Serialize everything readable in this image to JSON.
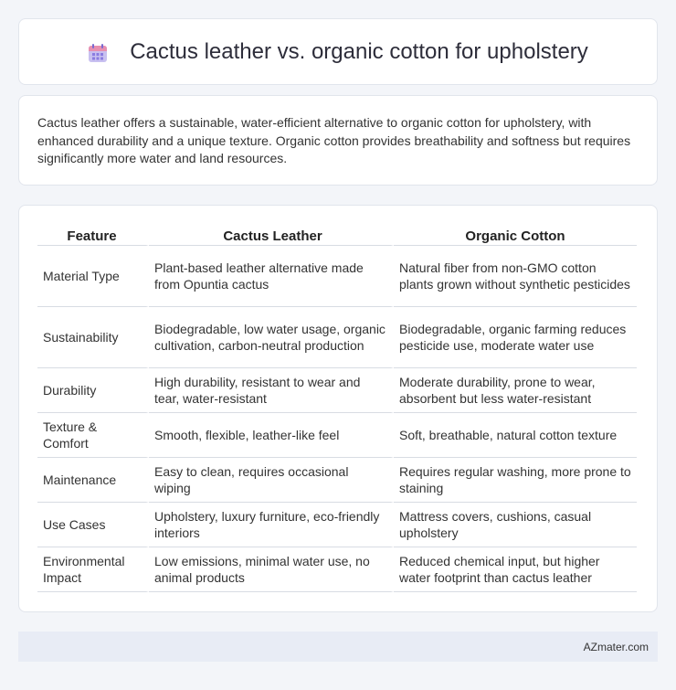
{
  "header": {
    "title": "Cactus leather vs. organic cotton for upholstery",
    "icon": "calendar-icon"
  },
  "intro": {
    "text": "Cactus leather offers a sustainable, water-efficient alternative to organic cotton for upholstery, with enhanced durability and a unique texture. Organic cotton provides breathability and softness but requires significantly more water and land resources."
  },
  "table": {
    "headers": [
      "Feature",
      "Cactus Leather",
      "Organic Cotton"
    ],
    "rows": [
      [
        "Material Type",
        "Plant-based leather alternative made from Opuntia cactus",
        "Natural fiber from non-GMO cotton plants grown without synthetic pesticides"
      ],
      [
        "Sustainability",
        "Biodegradable, low water usage, organic cultivation, carbon-neutral production",
        "Biodegradable, organic farming reduces pesticide use, moderate water use"
      ],
      [
        "Durability",
        "High durability, resistant to wear and tear, water-resistant",
        "Moderate durability, prone to wear, absorbent but less water-resistant"
      ],
      [
        "Texture & Comfort",
        "Smooth, flexible, leather-like feel",
        "Soft, breathable, natural cotton texture"
      ],
      [
        "Maintenance",
        "Easy to clean, requires occasional wiping",
        "Requires regular washing, more prone to staining"
      ],
      [
        "Use Cases",
        "Upholstery, luxury furniture, eco-friendly interiors",
        "Mattress covers, cushions, casual upholstery"
      ],
      [
        "Environmental Impact",
        "Low emissions, minimal water use, no animal products",
        "Reduced chemical input, but higher water footprint than cactus leather"
      ]
    ]
  },
  "footer": {
    "brand": "AZmater.com"
  },
  "colors": {
    "background": "#f3f5f9",
    "card": "#ffffff",
    "footer": "#e8ecf5",
    "icon_primary": "#9b8be0",
    "icon_accent": "#e88fb0"
  }
}
